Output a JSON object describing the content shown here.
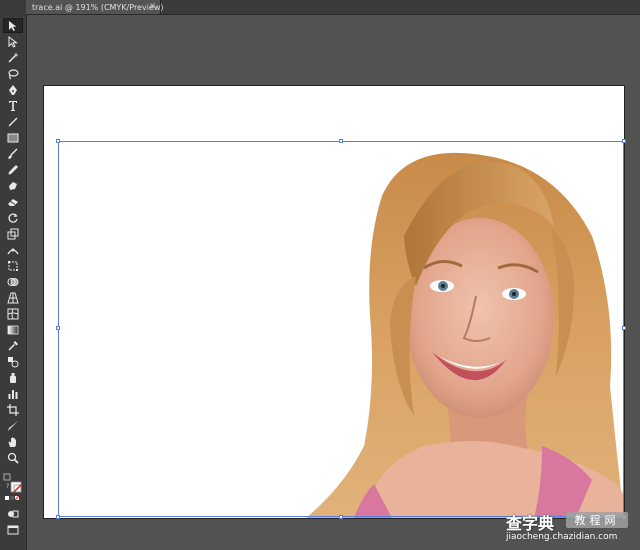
{
  "document": {
    "tab_title": "trace.ai @ 191% (CMYK/Preview)",
    "close_glyph": "×"
  },
  "toolbar": {
    "tools": [
      "selection-tool",
      "direct-selection-tool",
      "magic-wand-tool",
      "lasso-tool",
      "pen-tool",
      "type-tool",
      "line-segment-tool",
      "rectangle-tool",
      "paintbrush-tool",
      "pencil-tool",
      "blob-brush-tool",
      "eraser-tool",
      "rotate-tool",
      "scale-tool",
      "width-tool",
      "free-transform-tool",
      "shape-builder-tool",
      "perspective-grid-tool",
      "mesh-tool",
      "gradient-tool",
      "eyedropper-tool",
      "blend-tool",
      "symbol-sprayer-tool",
      "column-graph-tool",
      "artboard-tool",
      "slice-tool",
      "hand-tool",
      "zoom-tool"
    ],
    "active_tool": "selection-tool",
    "fill_color": "#ffffff",
    "stroke_color": "none"
  },
  "colors": {
    "workspace": "#535353",
    "selection": "#5b7fd8",
    "artboard": "#ffffff"
  },
  "watermark": {
    "logo": "查字典",
    "tag": "教程网",
    "url": "jiaocheng.chazidian.com"
  }
}
